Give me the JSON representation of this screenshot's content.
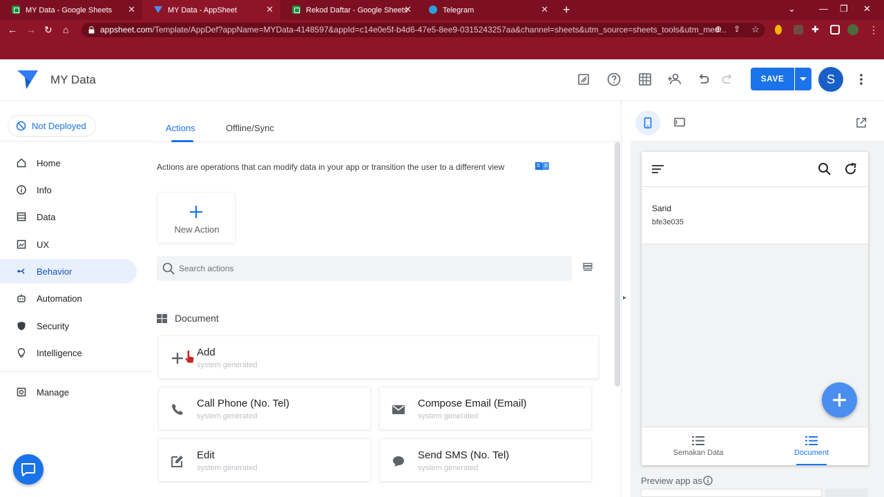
{
  "browser": {
    "tabs": [
      {
        "title": "MY Data - Google Sheets",
        "icon": "sheets-icon"
      },
      {
        "title": "MY Data - AppSheet",
        "icon": "appsheet-icon",
        "active": true
      },
      {
        "title": "Rekod Daftar - Google Sheets",
        "icon": "sheets-icon"
      },
      {
        "title": "Telegram",
        "icon": "telegram-icon"
      }
    ],
    "url_host": "appsheet.com",
    "url_rest": "/Template/AppDef?appName=MYData-4148597&appId=c14e0e5f-b4d6-47e5-8ee9-0315243257aa&channel=sheets&utm_source=sheets_tools&utm_med..."
  },
  "header": {
    "app_name": "MY Data",
    "save_label": "SAVE",
    "avatar_initial": "S"
  },
  "sidebar": {
    "deploy_status": "Not Deployed",
    "items": [
      {
        "label": "Home",
        "icon": "home-icon"
      },
      {
        "label": "Info",
        "icon": "info-icon"
      },
      {
        "label": "Data",
        "icon": "data-icon"
      },
      {
        "label": "UX",
        "icon": "ux-icon"
      },
      {
        "label": "Behavior",
        "icon": "behavior-icon",
        "active": true
      },
      {
        "label": "Automation",
        "icon": "automation-icon"
      },
      {
        "label": "Security",
        "icon": "shield-icon"
      },
      {
        "label": "Intelligence",
        "icon": "lightbulb-icon"
      }
    ],
    "manage_label": "Manage"
  },
  "main": {
    "tabs": [
      {
        "label": "Actions",
        "active": true
      },
      {
        "label": "Offline/Sync"
      }
    ],
    "description": "Actions are operations that can modify data in your app or transition the user to a different view",
    "new_action_label": "New Action",
    "search_placeholder": "Search actions",
    "section_title": "Document",
    "actions": [
      {
        "title": "Add",
        "subtitle": "system generated",
        "icon": "plus-icon"
      },
      {
        "title": "Call Phone (No. Tel)",
        "subtitle": "system generated",
        "icon": "phone-icon"
      },
      {
        "title": "Compose Email (Email)",
        "subtitle": "system generated",
        "icon": "email-icon"
      },
      {
        "title": "Edit",
        "subtitle": "system generated",
        "icon": "edit-icon"
      },
      {
        "title": "Send SMS (No. Tel)",
        "subtitle": "system generated",
        "icon": "sms-icon"
      }
    ]
  },
  "preview": {
    "record_name": "Sarid",
    "record_id": "bfe3e035",
    "nav": [
      {
        "label": "Semakan Data"
      },
      {
        "label": "Document",
        "active": true
      }
    ],
    "preview_as_label": "Preview app as"
  },
  "colors": {
    "chrome": "#8e1528",
    "accent": "#1a73e8",
    "fab": "#4a8ff0"
  }
}
